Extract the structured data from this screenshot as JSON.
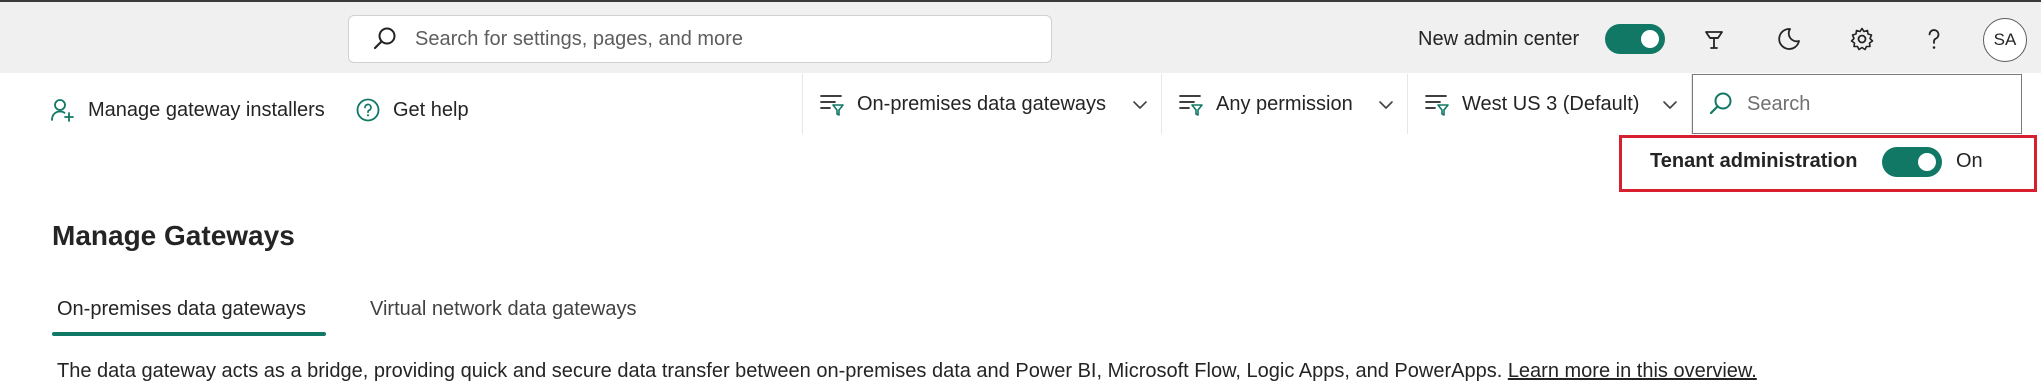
{
  "header": {
    "search_placeholder": "Search for settings, pages, and more",
    "new_admin_center_label": "New admin center",
    "new_admin_center_on": true,
    "avatar_initials": "SA"
  },
  "actions": {
    "manage_installers": "Manage gateway installers",
    "get_help": "Get help"
  },
  "filters": {
    "gateway_type": "On-premises data gateways",
    "permission": "Any permission",
    "region": "West US 3 (Default)",
    "search_placeholder": "Search"
  },
  "tenant_admin": {
    "label": "Tenant administration",
    "state": "On"
  },
  "page": {
    "title": "Manage Gateways",
    "tabs": [
      "On-premises data gateways",
      "Virtual network data gateways"
    ],
    "active_tab": "On-premises data gateways",
    "description": "The data gateway acts as a bridge, providing quick and secure data transfer between on-premises data and Power BI, Microsoft Flow, Logic Apps, and PowerApps.",
    "learn_more_link": "Learn more in this overview."
  },
  "colors": {
    "accent": "#117865",
    "highlight_border": "#d6202f",
    "topbar_bg": "#f0f0f0"
  },
  "icons": [
    "search-icon",
    "lightbulb-icon",
    "moon-icon",
    "gear-icon",
    "help-icon",
    "add-person-icon",
    "help-circle-icon",
    "filter-icon",
    "chevron-down-icon"
  ]
}
